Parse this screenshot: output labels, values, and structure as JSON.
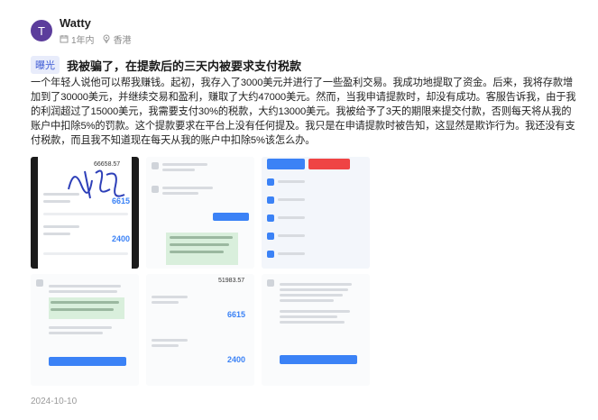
{
  "user": {
    "avatar_letter": "T",
    "name": "Watty",
    "time_ago": "1年内",
    "location": "香港"
  },
  "post": {
    "tag": "曝光",
    "title": "我被骗了，在提款后的三天内被要求支付税款",
    "body": "一个年轻人说他可以帮我赚钱。起初，我存入了3000美元并进行了一些盈利交易。我成功地提取了资金。后来，我将存款增加到了30000美元，并继续交易和盈利，赚取了大约47000美元。然而，当我申请提款时，却没有成功。客服告诉我，由于我的利润超过了15000美元，我需要支付30%的税款，大约13000美元。我被给予了3天的期限来提交付款，否则每天将从我的账户中扣除5%的罚款。这个提款要求在平台上没有任何提及。我只是在申请提款时被告知，这显然是欺诈行为。我还没有支付税款，而且我不知道现在每天从我的账户中扣除5%该怎么办。",
    "date": "2024-10-10"
  },
  "thumbnails": {
    "t1_amounts": [
      "6615",
      "2400"
    ],
    "t5_amounts": [
      "51983.57",
      "6615",
      "2400"
    ],
    "t1_top_amount": "66658.57"
  },
  "colors": {
    "tag_bg": "#e8ecfb",
    "tag_text": "#3e5bd4",
    "avatar": "#5c3d9c",
    "accent_blue": "#3b82f6"
  },
  "icons": [
    "calendar-icon",
    "location-icon"
  ]
}
